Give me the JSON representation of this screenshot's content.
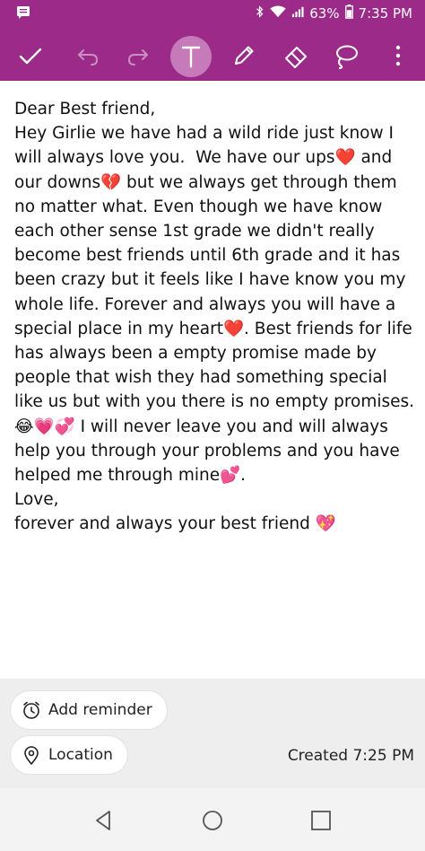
{
  "status_bar": {
    "battery": "63%",
    "time": "7:35 PM"
  },
  "toolbar": {
    "items": [
      "check-icon",
      "undo-icon",
      "redo-icon",
      "text-icon",
      "pen-icon",
      "eraser-icon",
      "lasso-icon",
      "more-icon"
    ],
    "active": "text-icon",
    "accent": "#9b2a88"
  },
  "note": {
    "text": "Dear Best friend,\nHey Girlie we have had a wild ride just know I will always love you.  We have our ups❤️ and our downs💔 but we always get through them no matter what. Even though we have know each other sense 1st grade we didn't really become best friends until 6th grade and it has been crazy but it feels like I have know you my whole life. Forever and always you will have a special place in my heart❤️. Best friends for life has always been a empty promise made by people that wish they had something special like us but with you there is no empty promises. 😂💗💞 I will never leave you and will always help you through your problems and you have helped me through mine💕.\nLove,\nforever and always your best friend 💖"
  },
  "bottom": {
    "reminder_label": "Add reminder",
    "location_label": "Location",
    "created": "Created 7:25 PM"
  }
}
